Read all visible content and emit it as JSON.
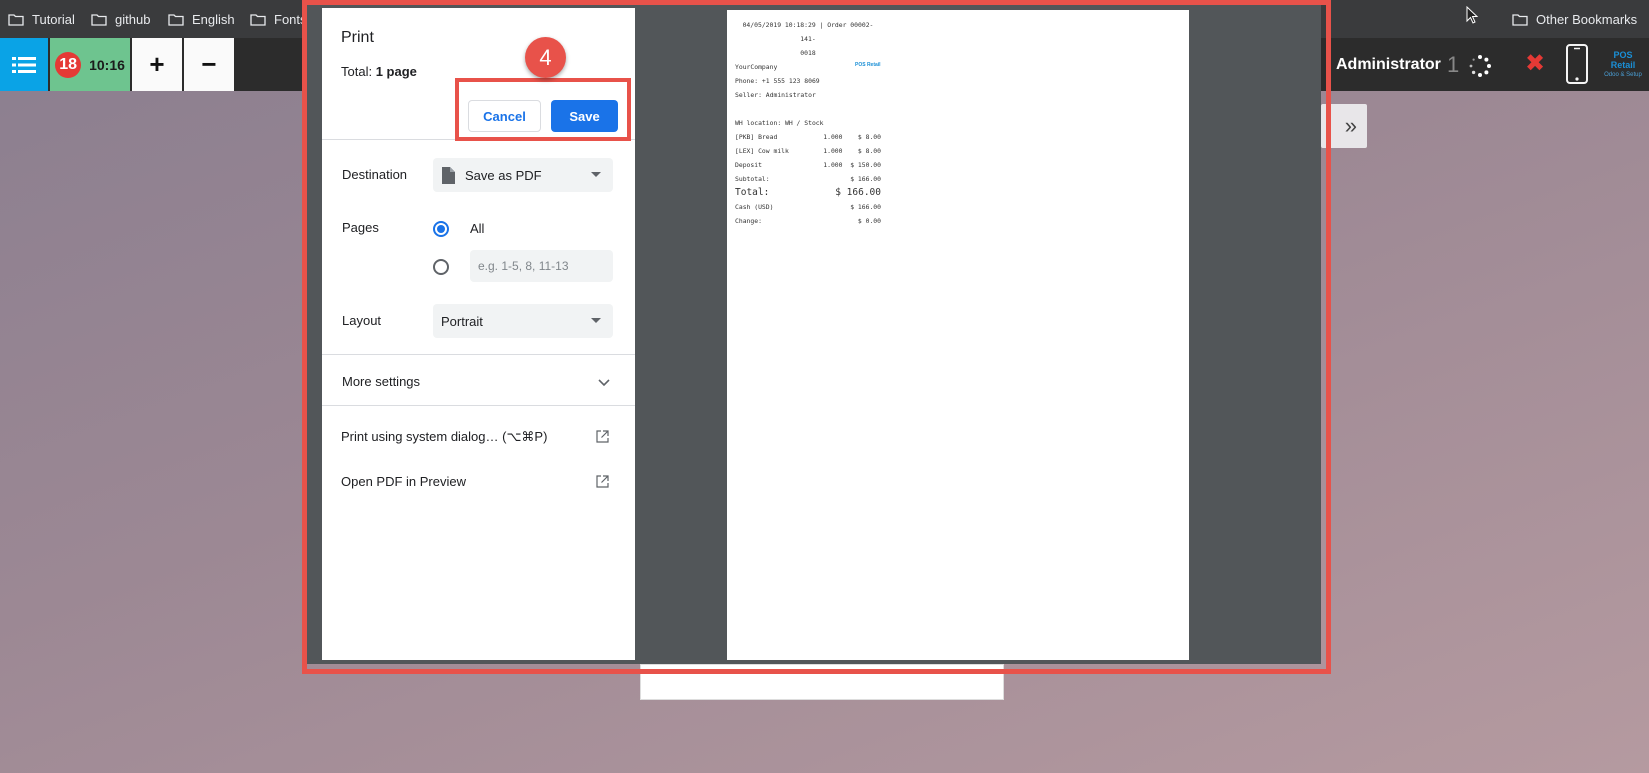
{
  "bookmarks": {
    "items": [
      {
        "label": "Tutorial"
      },
      {
        "label": "github"
      },
      {
        "label": "English"
      },
      {
        "label": "Fonts"
      }
    ],
    "other": "Other Bookmarks"
  },
  "pos": {
    "order_count": "18",
    "order_time": "10:16",
    "add_label": "+",
    "remove_label": "−",
    "user_name": "Administrator",
    "sync_count": "1",
    "close_label": "✖",
    "logo_text": "POS Retail",
    "logo_sub": "Odoo & Setup"
  },
  "print": {
    "title": "Print",
    "total_prefix": "Total: ",
    "total_value": "1 page",
    "cancel_label": "Cancel",
    "save_label": "Save",
    "destination_label": "Destination",
    "destination_value": "Save as PDF",
    "pages_label": "Pages",
    "pages_all_label": "All",
    "pages_placeholder": "e.g. 1-5, 8, 11-13",
    "layout_label": "Layout",
    "layout_value": "Portrait",
    "more_settings_label": "More settings",
    "system_dialog_label": "Print using system dialog… (⌥⌘P)",
    "open_pdf_label": "Open PDF in Preview"
  },
  "annotation": {
    "step_number": "4"
  },
  "receipt": {
    "header_line1": "04/05/2019 10:18:29 | Order 00002-141-",
    "header_line2": "0018",
    "company": "YourCompany",
    "logo_text": "POS Retail",
    "phone": "Phone: +1 555 123 8069",
    "seller": "Seller: Administrator",
    "location": "WH location: WH / Stock",
    "lines": [
      {
        "name": "[PKB] Bread",
        "qty": "1.000",
        "price": "$ 8.00"
      },
      {
        "name": "[LEX] Cow milk",
        "qty": "1.000",
        "price": "$ 8.00"
      },
      {
        "name": "Deposit",
        "qty": "1.000",
        "price": "$ 150.00"
      }
    ],
    "subtotal_label": "Subtotal:",
    "subtotal_value": "$ 166.00",
    "total_label": "Total:",
    "total_value": "$ 166.00",
    "cash_label": "Cash (USD)",
    "cash_value": "$ 166.00",
    "change_label": "Change:",
    "change_value": "$ 0.00"
  },
  "colors": {
    "accent": "#1a73e8",
    "annotation": "#e8524a",
    "pos_menu": "#0aa3e6",
    "pos_orders": "#6ec48f"
  }
}
